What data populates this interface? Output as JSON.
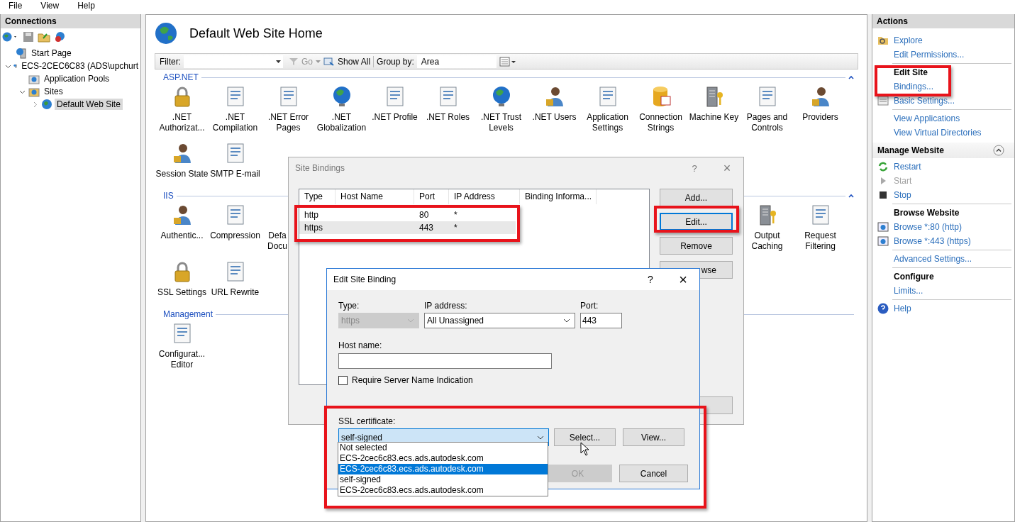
{
  "menu": [
    "File",
    "View",
    "Help"
  ],
  "connections": {
    "title": "Connections",
    "tree": [
      {
        "label": "Start Page",
        "selected": false
      },
      {
        "label": "ECS-2CEC6C83 (ADS\\upchurt",
        "selected": false,
        "expanded": true,
        "children": [
          {
            "label": "Application Pools",
            "selected": false
          },
          {
            "label": "Sites",
            "selected": false,
            "expanded": true,
            "children": [
              {
                "label": "Default Web Site",
                "selected": true,
                "expanded": false
              }
            ]
          }
        ]
      }
    ]
  },
  "page": {
    "title": "Default Web Site Home",
    "filter": {
      "label": "Filter:",
      "go": "Go",
      "show_all": "Show All",
      "group_by_label": "Group by:",
      "group_by": "Area"
    },
    "groups": [
      {
        "title": "ASP.NET",
        "rows": [
          [
            {
              "label": ".NET\nAuthorizat..."
            },
            {
              "label": ".NET\nCompilation"
            },
            {
              "label": ".NET Error\nPages"
            },
            {
              "label": ".NET\nGlobalization"
            },
            {
              "label": ".NET Profile"
            },
            {
              "label": ".NET Roles"
            },
            {
              "label": ".NET Trust\nLevels"
            },
            {
              "label": ".NET Users"
            },
            {
              "label": "Application\nSettings"
            },
            {
              "label": "Connection\nStrings"
            },
            {
              "label": "Machine Key"
            },
            {
              "label": "Pages and\nControls"
            },
            {
              "label": "Providers"
            }
          ],
          [
            {
              "label": "Session State"
            },
            {
              "label": "SMTP E-mail"
            }
          ]
        ]
      },
      {
        "title": "IIS",
        "rows": [
          [
            {
              "label": "Authentic..."
            },
            {
              "label": "Compression"
            },
            {
              "label": "Defa\nDocu",
              "kind": "cut"
            },
            {
              "label": "Output\nCaching"
            },
            {
              "label": "Request\nFiltering"
            }
          ],
          [
            {
              "label": "SSL Settings"
            },
            {
              "label": "URL Rewrite"
            }
          ]
        ]
      },
      {
        "title": "Management",
        "rows": [
          [
            {
              "label": "Configurat...\nEditor"
            }
          ]
        ]
      }
    ]
  },
  "actions": {
    "title": "Actions",
    "items": [
      {
        "kind": "link",
        "label": "Explore",
        "disabled": false
      },
      {
        "kind": "link",
        "label": "Edit Permissions...",
        "disabled": false
      },
      {
        "kind": "separator"
      },
      {
        "kind": "heading",
        "label": "Edit Site"
      },
      {
        "kind": "link",
        "label": "Bindings...",
        "disabled": false
      },
      {
        "kind": "link",
        "label": "Basic Settings...",
        "disabled": false
      },
      {
        "kind": "separator"
      },
      {
        "kind": "link",
        "label": "View Applications",
        "disabled": false
      },
      {
        "kind": "link",
        "label": "View Virtual Directories",
        "disabled": false
      },
      {
        "kind": "section",
        "label": "Manage Website",
        "expanded": true
      },
      {
        "kind": "link",
        "label": "Restart",
        "disabled": false
      },
      {
        "kind": "link",
        "label": "Start",
        "disabled": true
      },
      {
        "kind": "link",
        "label": "Stop",
        "disabled": false
      },
      {
        "kind": "separator"
      },
      {
        "kind": "heading",
        "label": "Browse Website"
      },
      {
        "kind": "link",
        "label": "Browse *:80 (http)",
        "disabled": false
      },
      {
        "kind": "link",
        "label": "Browse *:443 (https)",
        "disabled": false
      },
      {
        "kind": "separator"
      },
      {
        "kind": "link",
        "label": "Advanced Settings...",
        "disabled": false
      },
      {
        "kind": "separator"
      },
      {
        "kind": "heading",
        "label": "Configure"
      },
      {
        "kind": "link",
        "label": "Limits...",
        "disabled": false
      },
      {
        "kind": "separator"
      },
      {
        "kind": "link",
        "label": "Help",
        "disabled": false
      }
    ]
  },
  "site_bindings": {
    "title": "Site Bindings",
    "help": "?",
    "close": "×",
    "columns": [
      "Type",
      "Host Name",
      "Port",
      "IP Address",
      "Binding Informa..."
    ],
    "rows": [
      {
        "cells": [
          "http",
          "",
          "80",
          "*",
          ""
        ],
        "selected": false
      },
      {
        "cells": [
          "https",
          "",
          "443",
          "*",
          ""
        ],
        "selected": true
      }
    ],
    "buttons": [
      {
        "label": "Add...",
        "focused": false
      },
      {
        "label": "Edit...",
        "focused": true
      },
      {
        "label": "Remove",
        "focused": false
      },
      {
        "label": "wse",
        "focused": false,
        "kind": "cut"
      }
    ]
  },
  "edit_binding": {
    "title": "Edit Site Binding",
    "help": "?",
    "close": "×",
    "type_label": "Type:",
    "type": "https",
    "ip_label": "IP address:",
    "ip": "All Unassigned",
    "port_label": "Port:",
    "port": "443",
    "host_label": "Host name:",
    "sni": {
      "label": "Require Server Name Indication",
      "checked": false
    },
    "ssl_label": "SSL certificate:",
    "ssl": "self-signed",
    "select": "Select...",
    "view": "View...",
    "ok": {
      "label": "OK",
      "disabled": true
    },
    "cancel": "Cancel",
    "options": [
      {
        "label": "Not selected",
        "selected": false
      },
      {
        "label": "ECS-2cec6c83.ecs.ads.autodesk.com",
        "selected": false
      },
      {
        "label": "ECS-2cec6c83.ecs.ads.autodesk.com",
        "selected": true
      },
      {
        "label": "self-signed",
        "selected": false
      },
      {
        "label": "ECS-2cec6c83.ecs.ads.autodesk.com",
        "selected": false
      }
    ]
  }
}
